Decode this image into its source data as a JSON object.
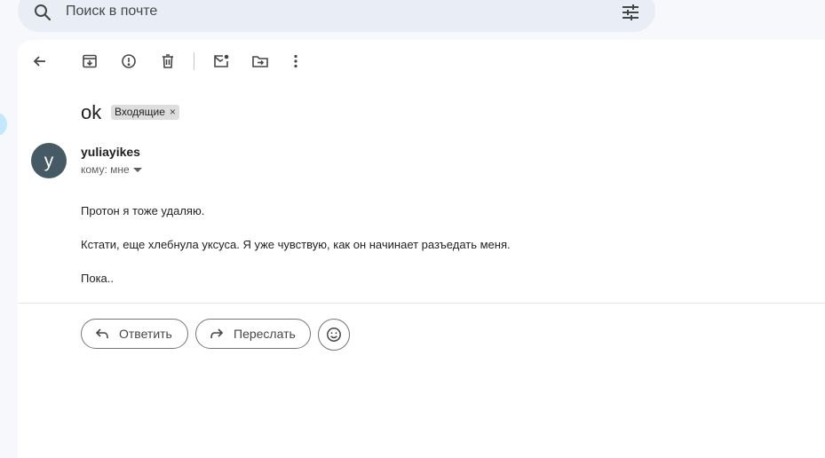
{
  "search": {
    "placeholder": "Поиск в почте",
    "search_icon": "search-icon",
    "filter_icon": "tune-icon"
  },
  "toolbar": {
    "icons": [
      "back-arrow-icon",
      "archive-icon",
      "report-spam-icon",
      "delete-icon",
      "mark-unread-icon",
      "move-to-icon",
      "more-vert-icon"
    ]
  },
  "message": {
    "subject": "ok",
    "label": "Входящие",
    "label_close": "×",
    "avatar_letter": "y",
    "sender": "yuliayikes",
    "recipient": "кому: мне",
    "body": [
      "Протон я тоже удаляю.",
      "Кстати, еще хлебнула уксуса. Я уже чувствую, как он начинает разъедать меня.",
      "Пока.."
    ]
  },
  "actions": {
    "reply_label": "Ответить",
    "forward_label": "Переслать",
    "emoji_icon": "emoji-icon"
  },
  "colors": {
    "page_bg": "#f6f8fc",
    "search_bg": "#e9eef6",
    "avatar_bg": "#455a64",
    "label_bg": "#dddddd"
  }
}
